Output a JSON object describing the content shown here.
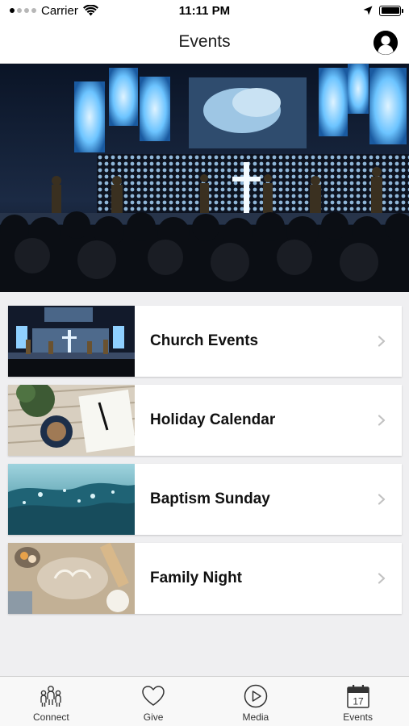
{
  "status_bar": {
    "carrier": "Carrier",
    "time": "11:11 PM",
    "wifi_icon": "wifi-icon",
    "location_icon": "location-arrow-icon",
    "battery_icon": "battery-icon"
  },
  "nav": {
    "title": "Events",
    "profile_icon": "user-circle-icon"
  },
  "hero": {
    "image": "worship-concert-photo"
  },
  "events": [
    {
      "title": "Church Events",
      "thumbnail": "worship-stage-photo"
    },
    {
      "title": "Holiday Calendar",
      "thumbnail": "desk-notebook-coffee-photo"
    },
    {
      "title": "Baptism Sunday",
      "thumbnail": "water-splash-photo"
    },
    {
      "title": "Family Night",
      "thumbnail": "baking-family-photo"
    }
  ],
  "tabs": [
    {
      "label": "Connect",
      "icon": "people-icon",
      "active": false
    },
    {
      "label": "Give",
      "icon": "heart-icon",
      "active": false
    },
    {
      "label": "Media",
      "icon": "play-circle-icon",
      "active": false
    },
    {
      "label": "Events",
      "icon": "calendar-icon",
      "icon_text": "17",
      "active": true
    }
  ],
  "colors": {
    "background": "#efeff1",
    "card": "#ffffff",
    "tab_bar": "#f8f8f8",
    "chevron": "#c2c2c2"
  }
}
